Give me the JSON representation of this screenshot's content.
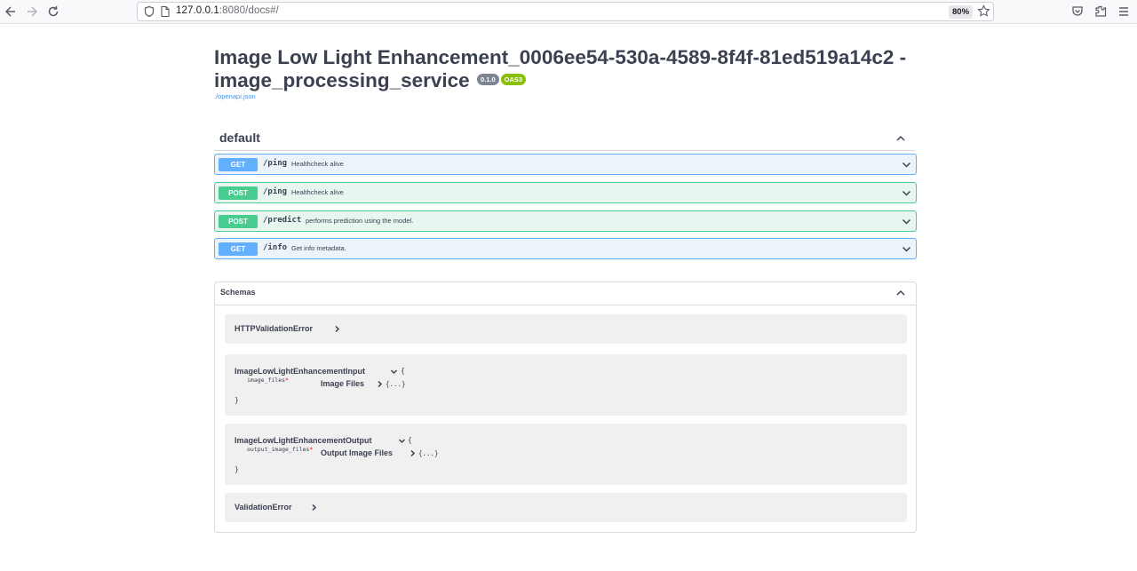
{
  "browser": {
    "url_host": "127.0.0.1",
    "url_rest": ":8080/docs#/",
    "zoom": "80%"
  },
  "info": {
    "title": "Image Low Light Enhancement_0006ee54-530a-4589-8f4f-81ed519a14c2 - image_processing_service",
    "version": "0.1.0",
    "oas": "OAS3",
    "spec_link": "./openapi.json"
  },
  "section": {
    "title": "default"
  },
  "operations": [
    {
      "method": "GET",
      "path": "/ping",
      "summary": "Healthcheck alive"
    },
    {
      "method": "POST",
      "path": "/ping",
      "summary": "Healthcheck alive"
    },
    {
      "method": "POST",
      "path": "/predict",
      "summary": "performs prediction using the model."
    },
    {
      "method": "GET",
      "path": "/info",
      "summary": "Get info metadata."
    }
  ],
  "schemas": {
    "title": "Schemas",
    "models": [
      {
        "name": "HTTPValidationError"
      },
      {
        "name": "ImageLowLightEnhancementInput",
        "open_brace": "{",
        "close_brace": "}",
        "prop_name": "image_files",
        "required": "*",
        "prop_type": "Image Files",
        "prop_tail": "{...}"
      },
      {
        "name": "ImageLowLightEnhancementOutput",
        "open_brace": "{",
        "close_brace": "}",
        "prop_name": "output_image_files",
        "required": "*",
        "prop_type": "Output Image Files",
        "prop_tail": "{...}"
      },
      {
        "name": "ValidationError"
      }
    ]
  }
}
